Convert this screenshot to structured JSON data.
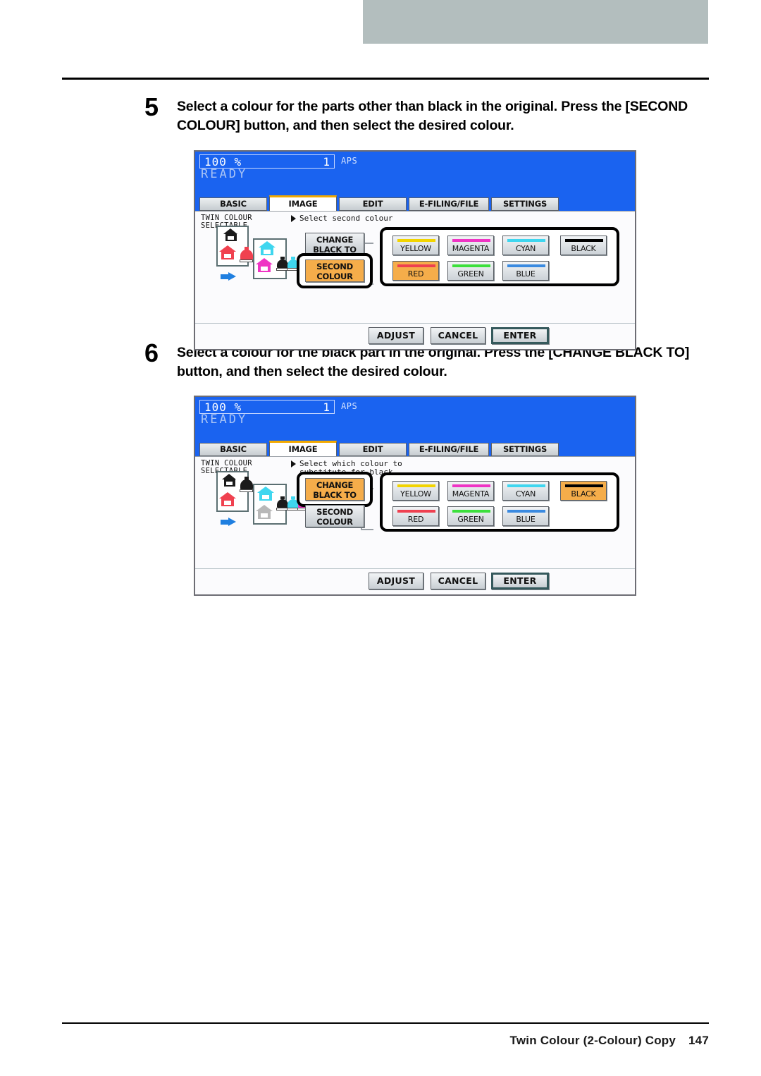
{
  "page": {
    "footer_title": "Twin Colour (2-Colour) Copy",
    "page_number": "147"
  },
  "steps": [
    {
      "number": "5",
      "text": "Select a colour for the parts other than black in the original. Press the [SECOND COLOUR] button, and then select the desired colour."
    },
    {
      "number": "6",
      "text": "Select a colour for the black part in the original. Press the [CHANGE BLACK TO] button, and then select the desired colour."
    }
  ],
  "panels": [
    {
      "header": {
        "zoom": "100 %",
        "copies": "1",
        "paper_mode": "APS",
        "status": "READY"
      },
      "tabs": [
        {
          "label": "BASIC",
          "active": false
        },
        {
          "label": "IMAGE",
          "active": true
        },
        {
          "label": "EDIT",
          "active": false
        },
        {
          "label": "E-FILING/FILE",
          "active": false
        },
        {
          "label": "SETTINGS",
          "active": false
        }
      ],
      "mode_label": "TWIN COLOUR\nSELECTABLE",
      "hint": "Select second colour",
      "mode_buttons": [
        {
          "label": "CHANGE\nBLACK TO",
          "selected": false
        },
        {
          "label": "SECOND\nCOLOUR",
          "selected": true
        }
      ],
      "colours": [
        {
          "label": "YELLOW",
          "swatch": "#f2d400",
          "selected": false
        },
        {
          "label": "MAGENTA",
          "swatch": "#ef34c4",
          "selected": false
        },
        {
          "label": "CYAN",
          "swatch": "#3fd6ef",
          "selected": false
        },
        {
          "label": "BLACK",
          "swatch": "#000000",
          "selected": false
        },
        {
          "label": "RED",
          "swatch": "#ef4050",
          "selected": true
        },
        {
          "label": "GREEN",
          "swatch": "#3ce03c",
          "selected": false
        },
        {
          "label": "BLUE",
          "swatch": "#3a8ae0",
          "selected": false
        }
      ],
      "foot_buttons": [
        {
          "label": "ADJUST",
          "primary": false
        },
        {
          "label": "CANCEL",
          "primary": false
        },
        {
          "label": "ENTER",
          "primary": true
        }
      ]
    },
    {
      "header": {
        "zoom": "100 %",
        "copies": "1",
        "paper_mode": "APS",
        "status": "READY"
      },
      "tabs": [
        {
          "label": "BASIC",
          "active": false
        },
        {
          "label": "IMAGE",
          "active": true
        },
        {
          "label": "EDIT",
          "active": false
        },
        {
          "label": "E-FILING/FILE",
          "active": false
        },
        {
          "label": "SETTINGS",
          "active": false
        }
      ],
      "mode_label": "TWIN COLOUR\nSELECTABLE",
      "hint": "Select which colour to\nsubstitute for black",
      "mode_buttons": [
        {
          "label": "CHANGE\nBLACK TO",
          "selected": true
        },
        {
          "label": "SECOND\nCOLOUR",
          "selected": false
        }
      ],
      "colours": [
        {
          "label": "YELLOW",
          "swatch": "#f2d400",
          "selected": false
        },
        {
          "label": "MAGENTA",
          "swatch": "#ef34c4",
          "selected": false
        },
        {
          "label": "CYAN",
          "swatch": "#3fd6ef",
          "selected": false
        },
        {
          "label": "BLACK",
          "swatch": "#000000",
          "selected": true
        },
        {
          "label": "RED",
          "swatch": "#ef4050",
          "selected": false
        },
        {
          "label": "GREEN",
          "swatch": "#3ce03c",
          "selected": false
        },
        {
          "label": "BLUE",
          "swatch": "#3a8ae0",
          "selected": false
        }
      ],
      "foot_buttons": [
        {
          "label": "ADJUST",
          "primary": false
        },
        {
          "label": "CANCEL",
          "primary": false
        },
        {
          "label": "ENTER",
          "primary": true
        }
      ]
    }
  ],
  "colors": {
    "lcd_blue": "#1a63f0",
    "selected_amber": "#f5ad4a",
    "tab_active_bar": "#f2a900",
    "grey_bar": "#b3bebe"
  }
}
